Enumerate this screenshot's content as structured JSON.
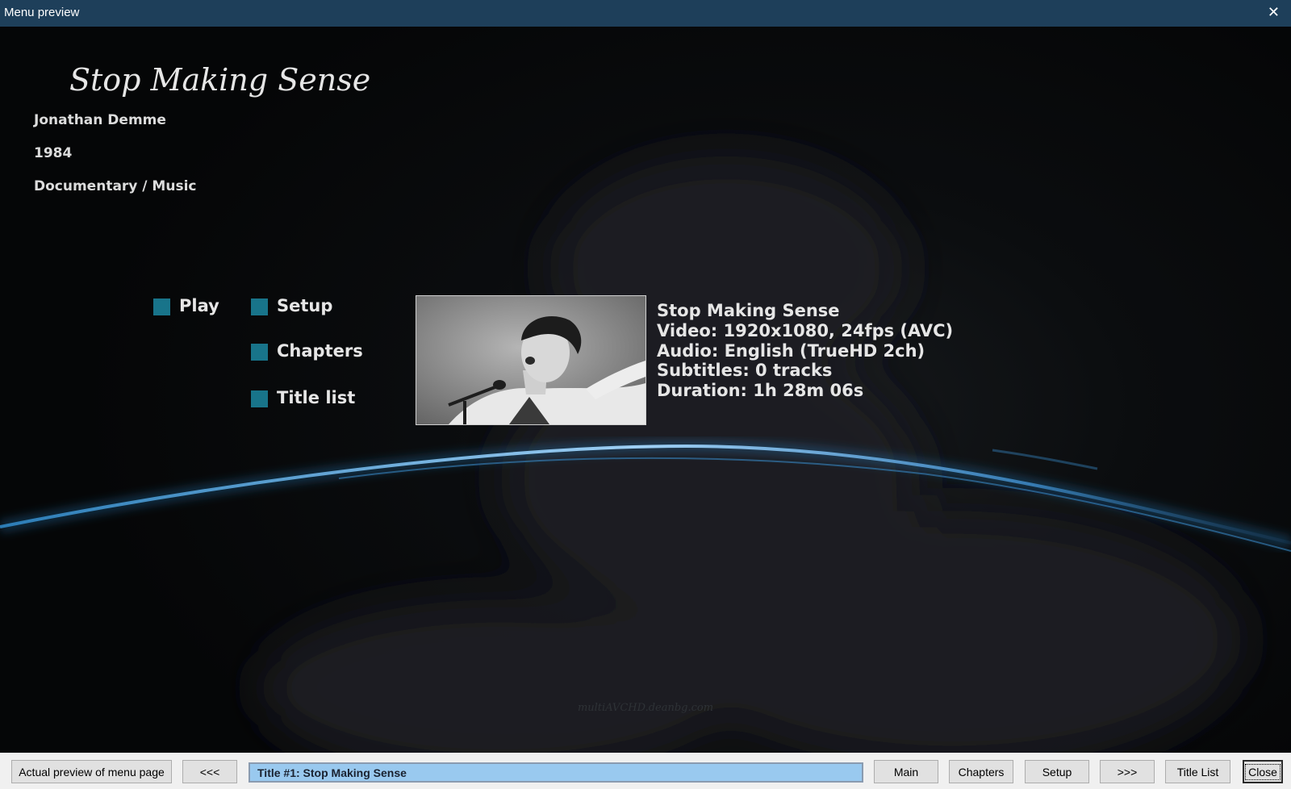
{
  "window": {
    "title": "Menu preview",
    "close_glyph": "✕"
  },
  "menu": {
    "title": "Stop Making Sense",
    "director": "Jonathan Demme",
    "year": "1984",
    "genre": "Documentary / Music",
    "buttons": {
      "play": "Play",
      "setup": "Setup",
      "chapters": "Chapters",
      "title_list": "Title list"
    },
    "details": {
      "name": "Stop Making Sense",
      "video": "Video: 1920x1080, 24fps (AVC)",
      "audio": "Audio: English (TrueHD 2ch)",
      "subtitles": "Subtitles: 0 tracks",
      "duration": "Duration: 1h 28m 06s"
    },
    "watermark": "multiAVCHD.deanbg.com",
    "accent_color": "#18748a"
  },
  "toolbar": {
    "actual_preview": "Actual preview of menu page",
    "prev": "<<<",
    "current_title": "Title #1: Stop Making Sense",
    "main": "Main",
    "chapters": "Chapters",
    "setup": "Setup",
    "next": ">>>",
    "title_list": "Title List",
    "close": "Close"
  }
}
